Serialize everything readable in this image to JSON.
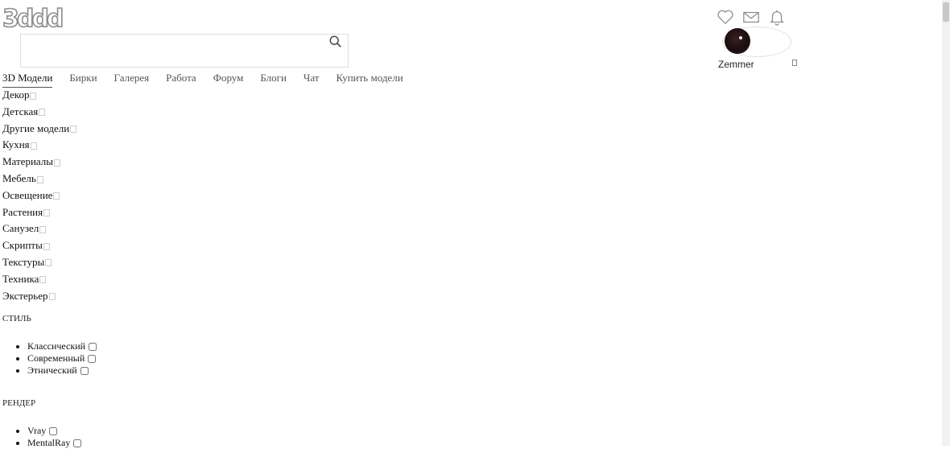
{
  "header": {
    "logo": "3ddd",
    "search": {
      "value": "",
      "placeholder": ""
    },
    "icons": [
      "heart-icon",
      "mail-icon",
      "bell-icon"
    ],
    "user": {
      "name": "Zemmer"
    }
  },
  "nav": {
    "items": [
      "3D Модели",
      "Бирки",
      "Галерея",
      "Работа",
      "Форум",
      "Блоги",
      "Чат",
      "Купить модели"
    ],
    "active": "3D Модели"
  },
  "categories": [
    "Декор",
    "Детская",
    "Другие модели",
    "Кухня",
    "Материалы",
    "Мебель",
    "Освещение",
    "Растения",
    "Санузел",
    "Скрипты",
    "Текстуры",
    "Техника",
    "Экстерьер"
  ],
  "style_filter": {
    "title": "СТИЛЬ",
    "options": [
      "Классический",
      "Современный",
      "Этнический"
    ]
  },
  "render_filter": {
    "title": "РЕНДЕР",
    "options": [
      "Vray",
      "MentalRay"
    ]
  }
}
